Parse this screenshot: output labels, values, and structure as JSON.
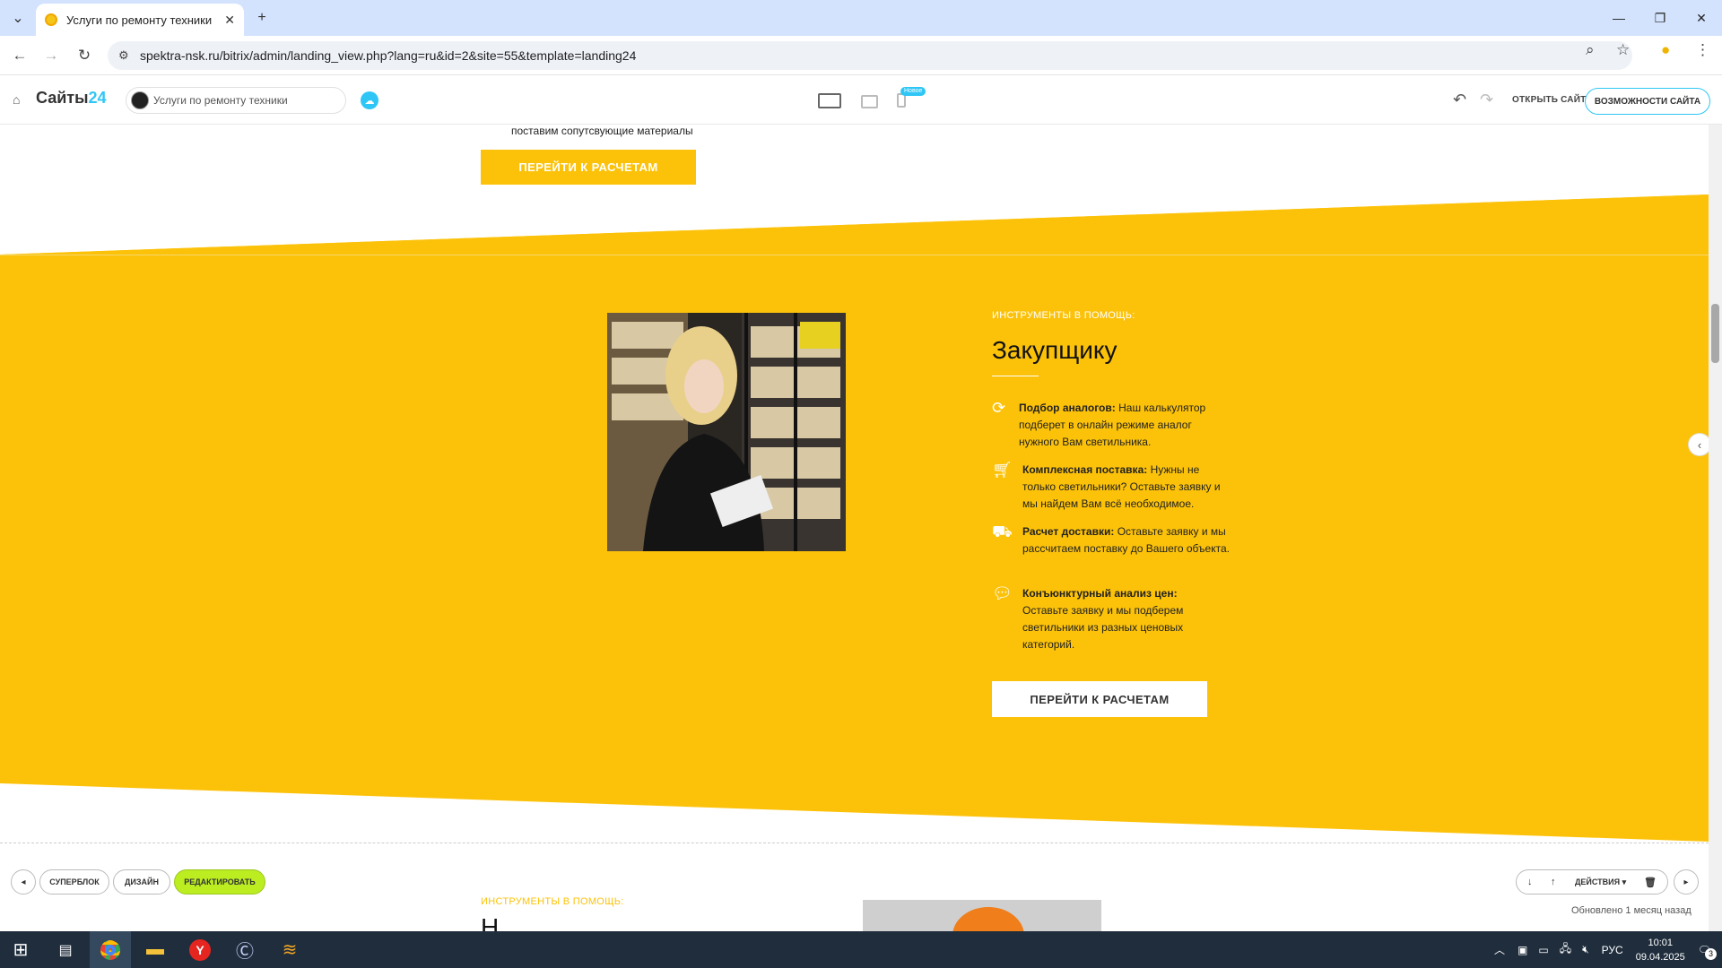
{
  "browser": {
    "tab_title": "Услуги по ремонту техники",
    "new_tab": "+",
    "url": "spektra-nsk.ru/bitrix/admin/landing_view.php?lang=ru&id=2&site=55&template=landing24"
  },
  "b24": {
    "logo_text": "Сайты",
    "logo_num": "24",
    "site_name": "Услуги по ремонту техники",
    "new_badge": "Новое",
    "open_site": "ОТКРЫТЬ САЙТ",
    "features": "ВОЗМОЖНОСТИ САЙТА"
  },
  "page": {
    "prev_text": "поставим сопутсвующие материалы",
    "prev_button": "ПЕРЕЙТИ К РАСЧЕТАМ",
    "eyebrow": "ИНСТРУМЕНТЫ В ПОМОЩЬ:",
    "heading": "Закупщику",
    "features": [
      {
        "title": "Подбор аналогов:",
        "text": " Наш калькулятор подберет в онлайн режиме аналог нужного Вам светильника."
      },
      {
        "title": "Комплексная поставка:",
        "text": " Нужны не только светильники? Оставьте заявку и мы найдем Вам всё необходимое."
      },
      {
        "title": "Расчет доставки:",
        "text": " Оставьте заявку и мы рассчитаем поставку до Вашего объекта."
      },
      {
        "title": "Конъюнктурный анализ цен:",
        "text": " Оставьте заявку и мы подберем светильники из разных ценовых категорий."
      }
    ],
    "button": "ПЕРЕЙТИ К РАСЧЕТАМ",
    "next_eyebrow": "ИНСТРУМЕНТЫ В ПОМОЩЬ:",
    "next_heading_partial": "Н"
  },
  "block_toolbar": {
    "superblock": "СУПЕРБЛОК",
    "design": "ДИЗАЙН",
    "edit": "РЕДАКТИРОВАТЬ",
    "actions": "ДЕЙСТВИЯ",
    "updated": "Обновлено 1 месяц назад"
  },
  "taskbar": {
    "lang": "РУС",
    "time": "10:01",
    "date": "09.04.2025",
    "notifications": "3"
  },
  "colors": {
    "accent_yellow": "#fcc20a",
    "b24_blue": "#2fc6f6",
    "edit_green": "#bbed21"
  }
}
